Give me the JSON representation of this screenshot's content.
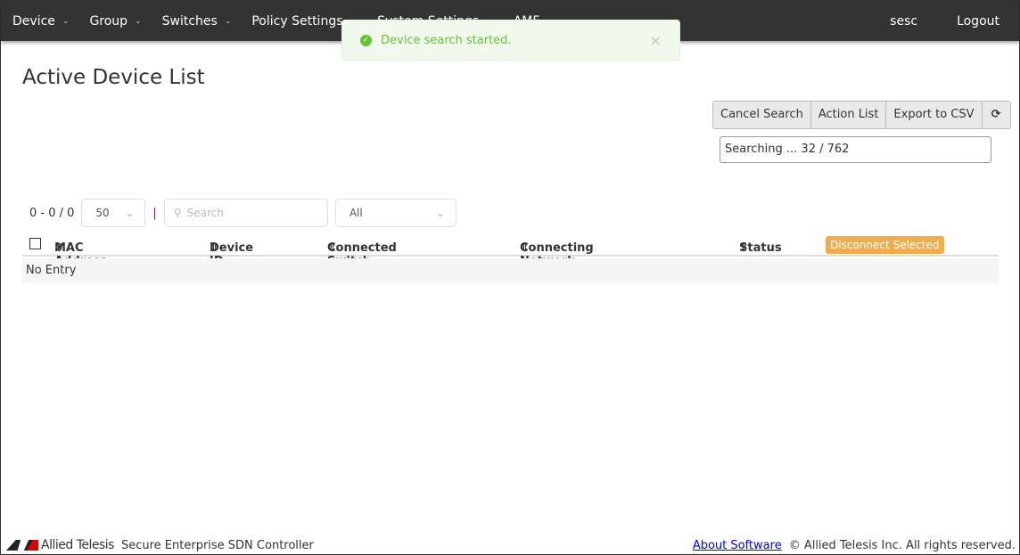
{
  "nav": {
    "items": [
      "Device",
      "Group",
      "Switches",
      "Policy Settings",
      "System Settings",
      "AMF"
    ],
    "user": "sesc",
    "logout": "Logout"
  },
  "toast": {
    "message": "Device search started."
  },
  "page": {
    "title": "Active Device List"
  },
  "toolbar": {
    "cancel": "Cancel Search",
    "action_list": "Action List",
    "export": "Export to CSV",
    "refresh_icon": "⟳"
  },
  "search_status": "Searching ... 32 / 762",
  "controls": {
    "range": "0 - 0 / 0",
    "page_size": "50",
    "search_placeholder": "Search",
    "filter": "All"
  },
  "table": {
    "columns": [
      "MAC Address",
      "Device ID",
      "Connected Switch",
      "Connecting Network",
      "Status"
    ],
    "disconnect": "Disconnect Selected",
    "empty": "No Entry"
  },
  "footer": {
    "brand": "Allied Telesis",
    "product": "Secure Enterprise SDN Controller",
    "about": "About Software",
    "copyright": "© Allied Telesis Inc. All rights reserved."
  }
}
